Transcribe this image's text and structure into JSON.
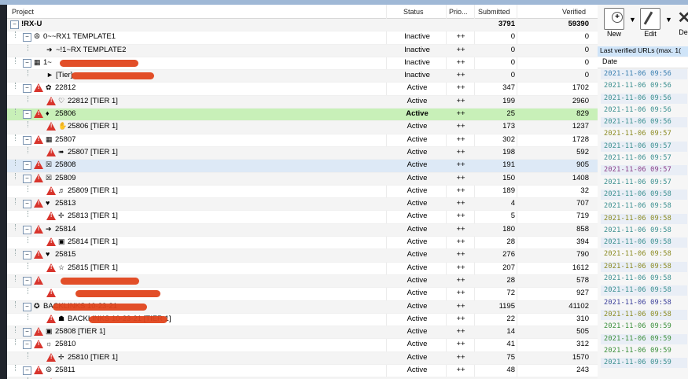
{
  "columns": {
    "project": "Project",
    "status": "Status",
    "priority": "Prio...",
    "submitted": "Submitted",
    "verified": "Verified"
  },
  "rows": [
    {
      "name": "!RX-U",
      "status": "",
      "prio": "",
      "sub": "3791",
      "ver": "59390",
      "bold": true
    },
    {
      "name": "0~~RX1 TEMPLATE1",
      "status": "Inactive",
      "prio": "++",
      "sub": "0",
      "ver": "0"
    },
    {
      "name": "~!1~RX TEMPLATE2",
      "status": "Inactive",
      "prio": "++",
      "sub": "0",
      "ver": "0"
    },
    {
      "name": "1~",
      "status": "Inactive",
      "prio": "++",
      "sub": "0",
      "ver": "0"
    },
    {
      "name": "[Tier]",
      "status": "Inactive",
      "prio": "++",
      "sub": "0",
      "ver": "0"
    },
    {
      "name": "22812",
      "status": "Active",
      "prio": "++",
      "sub": "347",
      "ver": "1702"
    },
    {
      "name": "22812 [TIER 1]",
      "status": "Active",
      "prio": "++",
      "sub": "199",
      "ver": "2960"
    },
    {
      "name": "25806",
      "status": "Active",
      "prio": "++",
      "sub": "25",
      "ver": "829",
      "selected": true
    },
    {
      "name": "25806 [TIER 1]",
      "status": "Active",
      "prio": "++",
      "sub": "173",
      "ver": "1237"
    },
    {
      "name": "25807",
      "status": "Active",
      "prio": "++",
      "sub": "302",
      "ver": "1728"
    },
    {
      "name": "25807 [TIER 1]",
      "status": "Active",
      "prio": "++",
      "sub": "198",
      "ver": "592"
    },
    {
      "name": "25808",
      "status": "Active",
      "prio": "++",
      "sub": "191",
      "ver": "905"
    },
    {
      "name": "25809",
      "status": "Active",
      "prio": "++",
      "sub": "150",
      "ver": "1408"
    },
    {
      "name": "25809 [TIER 1]",
      "status": "Active",
      "prio": "++",
      "sub": "189",
      "ver": "32"
    },
    {
      "name": "25813",
      "status": "Active",
      "prio": "++",
      "sub": "4",
      "ver": "707"
    },
    {
      "name": "25813 [TIER 1]",
      "status": "Active",
      "prio": "++",
      "sub": "5",
      "ver": "719"
    },
    {
      "name": "25814",
      "status": "Active",
      "prio": "++",
      "sub": "180",
      "ver": "858"
    },
    {
      "name": "25814 [TIER 1]",
      "status": "Active",
      "prio": "++",
      "sub": "28",
      "ver": "394"
    },
    {
      "name": "25815",
      "status": "Active",
      "prio": "++",
      "sub": "276",
      "ver": "790"
    },
    {
      "name": "25815 [TIER 1]",
      "status": "Active",
      "prio": "++",
      "sub": "207",
      "ver": "1612"
    },
    {
      "name": "",
      "status": "Active",
      "prio": "++",
      "sub": "28",
      "ver": "578"
    },
    {
      "name": "",
      "status": "Active",
      "prio": "++",
      "sub": "72",
      "ver": "927"
    },
    {
      "name": "BACKLINKS 10-23-21",
      "status": "Active",
      "prio": "++",
      "sub": "1195",
      "ver": "41102"
    },
    {
      "name": "BACKLINKS 10-23-21 [TIER 1]",
      "status": "Active",
      "prio": "++",
      "sub": "22",
      "ver": "310"
    },
    {
      "name": "25808 [TIER 1]",
      "status": "Active",
      "prio": "++",
      "sub": "14",
      "ver": "505"
    },
    {
      "name": "25810",
      "status": "Active",
      "prio": "++",
      "sub": "41",
      "ver": "312"
    },
    {
      "name": "25810 [TIER 1]",
      "status": "Active",
      "prio": "++",
      "sub": "75",
      "ver": "1570"
    },
    {
      "name": "25811",
      "status": "Active",
      "prio": "++",
      "sub": "48",
      "ver": "243"
    },
    {
      "name": "25811 [TIER 1]",
      "status": "Active",
      "prio": "++",
      "sub": "164",
      "ver": "1873"
    }
  ],
  "toolbar": {
    "new_label": "New",
    "edit_label": "Edit",
    "delete_label": "Del"
  },
  "side": {
    "header": "Last verified URLs (max. 1(",
    "date_col": "Date",
    "dates": [
      "2021-11-06 09:56",
      "2021-11-06 09:56",
      "2021-11-06 09:56",
      "2021-11-06 09:56",
      "2021-11-06 09:56",
      "2021-11-06 09:57",
      "2021-11-06 09:57",
      "2021-11-06 09:57",
      "2021-11-06 09:57",
      "2021-11-06 09:57",
      "2021-11-06 09:58",
      "2021-11-06 09:58",
      "2021-11-06 09:58",
      "2021-11-06 09:58",
      "2021-11-06 09:58",
      "2021-11-06 09:58",
      "2021-11-06 09:58",
      "2021-11-06 09:58",
      "2021-11-06 09:58",
      "2021-11-06 09:58",
      "2021-11-06 09:58",
      "2021-11-06 09:59",
      "2021-11-06 09:59",
      "2021-11-06 09:59",
      "2021-11-06 09:59"
    ],
    "date_colors": [
      "#3a7fb0",
      "#3a8f8f",
      "#3a8f8f",
      "#3a8f8f",
      "#3a8f8f",
      "#8a8a20",
      "#3a8f8f",
      "#3a8f8f",
      "#8a3f8a",
      "#3a8f8f",
      "#3a8f8f",
      "#3a8f8f",
      "#8a8a20",
      "#3a8f8f",
      "#3a8f8f",
      "#8a8a20",
      "#8a8a20",
      "#3a8f8f",
      "#3a8f8f",
      "#3a3f9a",
      "#8a8a20",
      "#3a8f3a",
      "#3a8f3a",
      "#3a8f3a",
      "#3a8f8f"
    ]
  }
}
